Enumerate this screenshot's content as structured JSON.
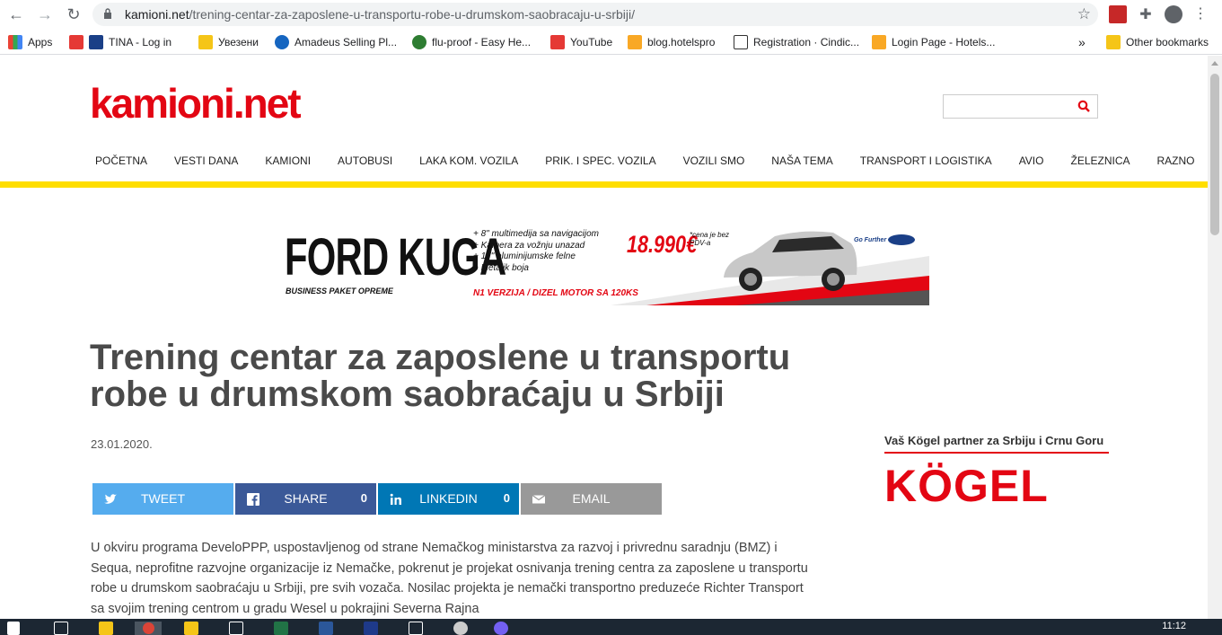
{
  "browser": {
    "url_host": "kamioni.net",
    "url_path": "/trening-centar-za-zaposlene-u-transportu-robe-u-drumskom-saobracaju-u-srbiji/",
    "bookmarks": [
      {
        "label": "Apps"
      },
      {
        "label": "TINA - Log in"
      },
      {
        "label": "Увезени"
      },
      {
        "label": "Amadeus Selling Pl..."
      },
      {
        "label": "flu-proof - Easy He..."
      },
      {
        "label": "YouTube"
      },
      {
        "label": "blog.hotelspro"
      },
      {
        "label": "Registration · Cindic..."
      },
      {
        "label": "Login Page - Hotels..."
      },
      {
        "label": "»"
      },
      {
        "label": "Other bookmarks"
      }
    ]
  },
  "site": {
    "logo": "kamioni.net",
    "nav": [
      "POČETNA",
      "VESTI DANA",
      "KAMIONI",
      "AUTOBUSI",
      "LAKA KOM. VOZILA",
      "PRIK. I SPEC. VOZILA",
      "VOZILI SMO",
      "NAŠA TEMA",
      "TRANSPORT I LOGISTIKA",
      "AVIO",
      "ŽELEZNICA",
      "RAZNO"
    ],
    "search_placeholder": ""
  },
  "banner": {
    "brand": "FORD KUGA",
    "subtitle": "BUSINESS PAKET OPREME",
    "features": [
      "+ 8\" multimedija sa navigacijom",
      "+ Kamera za vožnju unazad",
      "+ 17\" aluminijumske felne",
      "+ Metalik boja"
    ],
    "price": "18.990€",
    "price_note": "*cena je bez PDV-a",
    "engine": "N1 VERZIJA / DIZEL MOTOR SA 120KS",
    "tagline": "Go Further"
  },
  "article": {
    "title": "Trening centar za zaposlene u transportu robe u drumskom saobraćaju u Srbiji",
    "date": "23.01.2020.",
    "share": [
      {
        "label": "TWEET",
        "count": "",
        "color": "#55acee"
      },
      {
        "label": "SHARE",
        "count": "0",
        "color": "#3b5998"
      },
      {
        "label": "LINKEDIN",
        "count": "0",
        "color": "#0077b5"
      },
      {
        "label": "EMAIL",
        "count": "",
        "color": "#999999"
      }
    ],
    "body": "U okviru programa DeveloPPP, uspostavljenog od strane Nemačkog ministarstva za razvoj i privrednu saradnju (BMZ) i Sequa, neprofitne razvojne organizacije iz Nemačke, pokrenut je projekat osnivanja trening centra za zaposlene u transportu robe u drumskom saobraćaju u Srbiji, pre svih vozača. Nosilac projekta je nemački transportno preduzeće Richter Transport sa svojim trening centrom u gradu Wesel u pokrajini Severna Rajna"
  },
  "sidebar_ad": {
    "tagline": "Vaš Kögel partner za Srbiju i Crnu Goru",
    "brand": "KÖGEL"
  },
  "taskbar": {
    "time": "11:12"
  },
  "colors": {
    "brand_red": "#e30613",
    "nav_yellow": "#ffde00"
  }
}
